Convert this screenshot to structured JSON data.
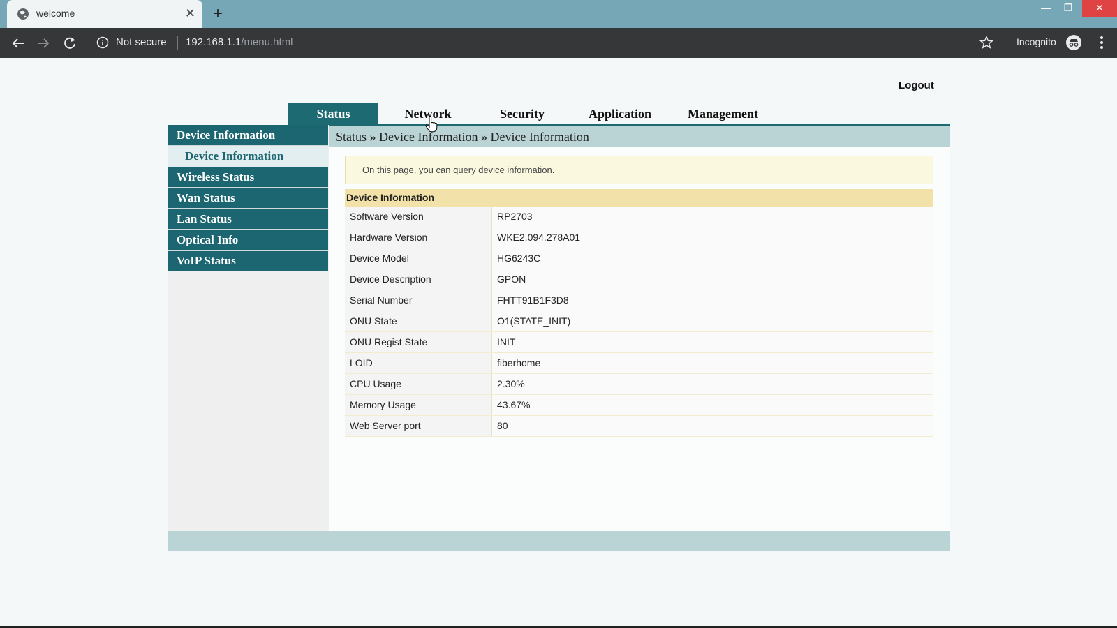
{
  "browser": {
    "tab_title": "welcome",
    "new_tab": "+",
    "security_label": "Not secure",
    "url_host": "192.168.1.1",
    "url_path": "/menu.html",
    "incognito_label": "Incognito"
  },
  "page": {
    "logout": "Logout",
    "topnav": [
      {
        "label": "Status",
        "active": true
      },
      {
        "label": "Network",
        "active": false
      },
      {
        "label": "Security",
        "active": false
      },
      {
        "label": "Application",
        "active": false
      },
      {
        "label": "Management",
        "active": false
      }
    ],
    "sidebar": {
      "section": "Device Information",
      "sub_item": "Device Information",
      "items": [
        "Wireless Status",
        "Wan Status",
        "Lan Status",
        "Optical Info",
        "VoIP Status"
      ]
    },
    "breadcrumb": "Status » Device Information » Device Information",
    "notice": "On this page, you can query device information.",
    "table": {
      "title": "Device Information",
      "rows": [
        {
          "label": "Software Version",
          "value": "RP2703"
        },
        {
          "label": "Hardware Version",
          "value": "WKE2.094.278A01"
        },
        {
          "label": "Device Model",
          "value": "HG6243C"
        },
        {
          "label": "Device Description",
          "value": "GPON"
        },
        {
          "label": "Serial Number",
          "value": "FHTT91B1F3D8"
        },
        {
          "label": "ONU State",
          "value": "O1(STATE_INIT)"
        },
        {
          "label": "ONU Regist State",
          "value": "INIT"
        },
        {
          "label": "LOID",
          "value": "fiberhome"
        },
        {
          "label": "CPU Usage",
          "value": "2.30%"
        },
        {
          "label": "Memory Usage",
          "value": "43.67%"
        },
        {
          "label": "Web Server port",
          "value": "80"
        }
      ]
    }
  },
  "colors": {
    "accent": "#1b6670",
    "breadcrumb_bg": "#bad3d5",
    "table_header_bg": "#f2e1a8",
    "notice_bg": "#fbf8e0"
  }
}
